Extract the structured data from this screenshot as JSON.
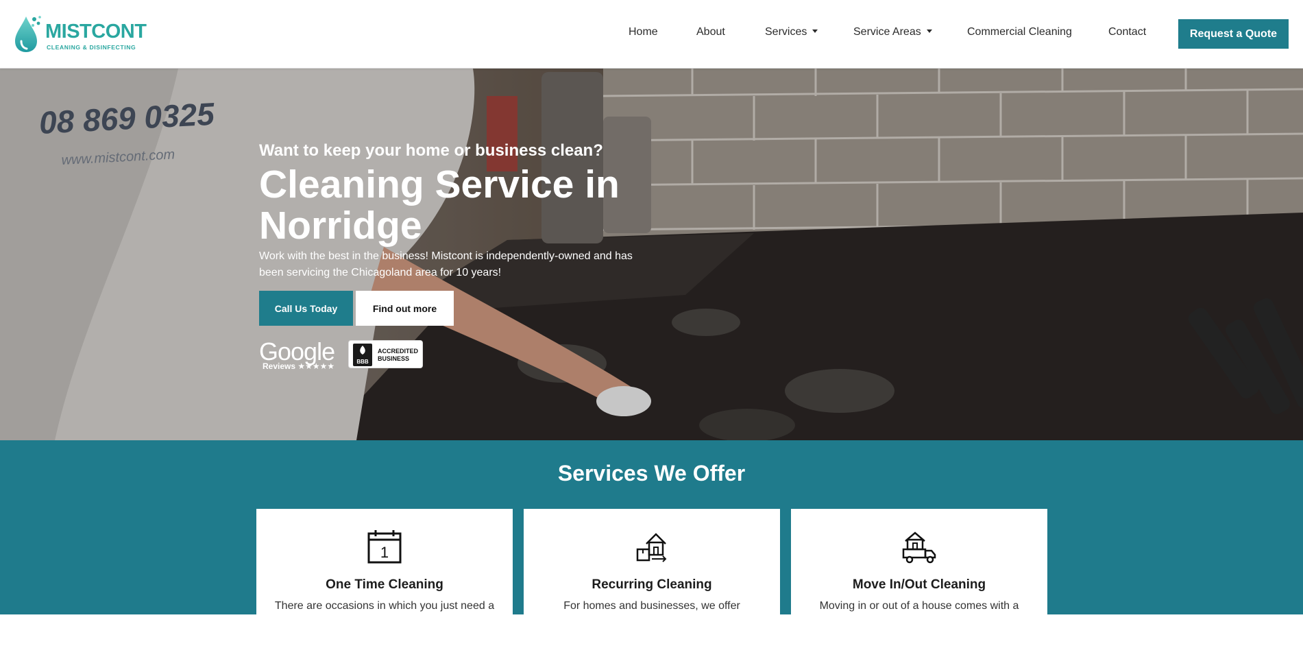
{
  "brand": {
    "name": "MISTCONT",
    "tagline": "CLEANING & DISINFECTING",
    "color": "#2aa7a0"
  },
  "nav": {
    "items": [
      {
        "label": "Home",
        "dropdown": false
      },
      {
        "label": "About",
        "dropdown": false
      },
      {
        "label": "Services",
        "dropdown": true
      },
      {
        "label": "Service Areas",
        "dropdown": true
      },
      {
        "label": "Commercial Cleaning",
        "dropdown": false
      },
      {
        "label": "Contact",
        "dropdown": false
      }
    ],
    "cta_label": "Request a Quote",
    "cta_color": "#1f7d8c"
  },
  "hero": {
    "kicker": "Want to keep your home or business clean?",
    "title": "Cleaning Service in Norridge",
    "text": "Work with the best in the business! Mistcont is independently-owned and has been servicing the Chicagoland area for 10 years!",
    "primary_button": "Call Us Today",
    "secondary_button": "Find out more",
    "shirt_phone": "08 869 0325",
    "shirt_site": "www.mistcont.com",
    "badges": {
      "google_word": "Google",
      "google_sub": "Reviews ★★★★★",
      "bbb_mark": "BBB",
      "bbb_line1": "ACCREDITED",
      "bbb_line2": "BUSINESS"
    }
  },
  "services": {
    "title": "Services We Offer",
    "background": "#1f7b8c",
    "cards": [
      {
        "icon": "calendar-icon",
        "icon_text": "1",
        "title": "One Time Cleaning",
        "text": "There are occasions in which you just need a"
      },
      {
        "icon": "house-box-icon",
        "title": "Recurring Cleaning",
        "text": "For homes and businesses, we offer"
      },
      {
        "icon": "moving-truck-icon",
        "title": "Move In/Out Cleaning",
        "text": "Moving in or out of a house comes with a"
      }
    ]
  }
}
